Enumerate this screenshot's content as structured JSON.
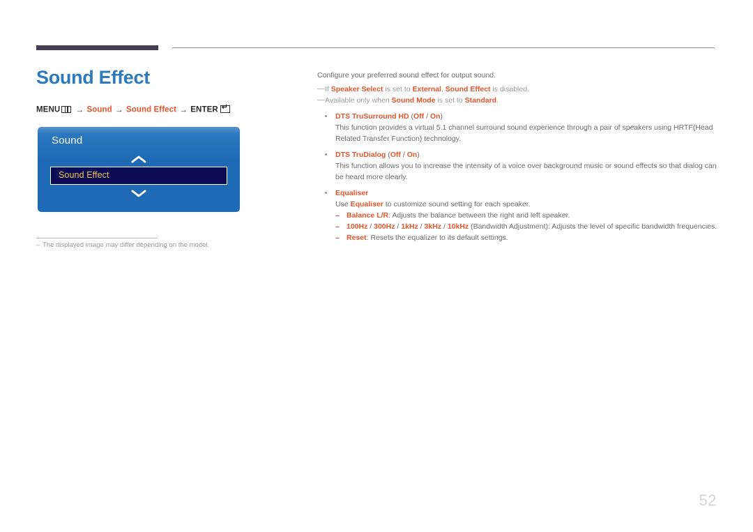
{
  "page": {
    "number": "52"
  },
  "header": {
    "title": "Sound Effect",
    "menu_path": {
      "menu_label": "MENU",
      "menu_icon": "menu-grid-icon",
      "arrow": "→",
      "step1": "Sound",
      "step2": "Sound Effect",
      "enter_label": "ENTER",
      "enter_icon": "enter-return-icon"
    }
  },
  "tv_menu": {
    "title": "Sound",
    "scroll_up_icon": "chevron-up-icon",
    "scroll_down_icon": "chevron-down-icon",
    "selected_item": "Sound Effect"
  },
  "left_footnote": {
    "dash": "–",
    "text": "The displayed image may differ depending on the model."
  },
  "content": {
    "intro": "Configure your preferred sound effect for output sound.",
    "notes": [
      {
        "dash": "—",
        "parts": [
          {
            "text": "If ",
            "accent": false
          },
          {
            "text": "Speaker Select",
            "accent": true
          },
          {
            "text": " is set to ",
            "accent": false
          },
          {
            "text": "External",
            "accent": true
          },
          {
            "text": ", ",
            "accent": false
          },
          {
            "text": "Sound Effect",
            "accent": true
          },
          {
            "text": " is disabled.",
            "accent": false
          }
        ]
      },
      {
        "dash": "—",
        "parts": [
          {
            "text": "Available only when ",
            "accent": false
          },
          {
            "text": "Sound Mode",
            "accent": true
          },
          {
            "text": " is set to ",
            "accent": false
          },
          {
            "text": "Standard",
            "accent": true
          },
          {
            "text": ".",
            "accent": false
          }
        ]
      }
    ],
    "bullets": [
      {
        "title": "DTS TruSurround HD",
        "options": "(Off / On)",
        "body_parts": [
          {
            "text": "This function provides a virtual 5.1 channel surround sound experience through a pair of speakers using HRTF(Head Related Transfer Function) technology.",
            "accent": false
          }
        ],
        "sub_items": []
      },
      {
        "title": "DTS TruDialog",
        "options": "(Off / On)",
        "body_parts": [
          {
            "text": "This function allows you to increase the intensity of a voice over background music or sound effects so that dialog can be heard more clearly.",
            "accent": false
          }
        ],
        "sub_items": []
      },
      {
        "title": "Equaliser",
        "options": "",
        "body_parts": [
          {
            "text": "Use ",
            "accent": false
          },
          {
            "text": "Equaliser",
            "accent": true
          },
          {
            "text": " to customize sound setting for each speaker.",
            "accent": false
          }
        ],
        "sub_items": [
          {
            "dash": "–",
            "parts": [
              {
                "text": "Balance L/R",
                "accent": true
              },
              {
                "text": ": Adjusts the balance between the right and left speaker.",
                "accent": false
              }
            ]
          },
          {
            "dash": "–",
            "parts": [
              {
                "text": "100Hz",
                "accent": true
              },
              {
                "text": " / ",
                "accent": false
              },
              {
                "text": "300Hz",
                "accent": true
              },
              {
                "text": " / ",
                "accent": false
              },
              {
                "text": "1kHz",
                "accent": true
              },
              {
                "text": " / ",
                "accent": false
              },
              {
                "text": "3kHz",
                "accent": true
              },
              {
                "text": " / ",
                "accent": false
              },
              {
                "text": "10kHz",
                "accent": true
              },
              {
                "text": " (Bandwidth Adjustment): Adjusts the level of specific bandwidth frequencies.",
                "accent": false
              }
            ]
          },
          {
            "dash": "–",
            "parts": [
              {
                "text": "Reset",
                "accent": true
              },
              {
                "text": ": Resets the equalizer to its default settings.",
                "accent": false
              }
            ]
          }
        ]
      }
    ]
  },
  "colors": {
    "accent": "#e8542b",
    "title_blue": "#2c7abd",
    "rule_purple": "#463d52",
    "panel_blue": "#1f6ab4",
    "selected_row": "#0b0b55",
    "selected_text": "#f0c14b",
    "body_gray": "#6b6b6b",
    "note_gray": "#9a9a9a",
    "page_num_gray": "#d4d4d4"
  }
}
